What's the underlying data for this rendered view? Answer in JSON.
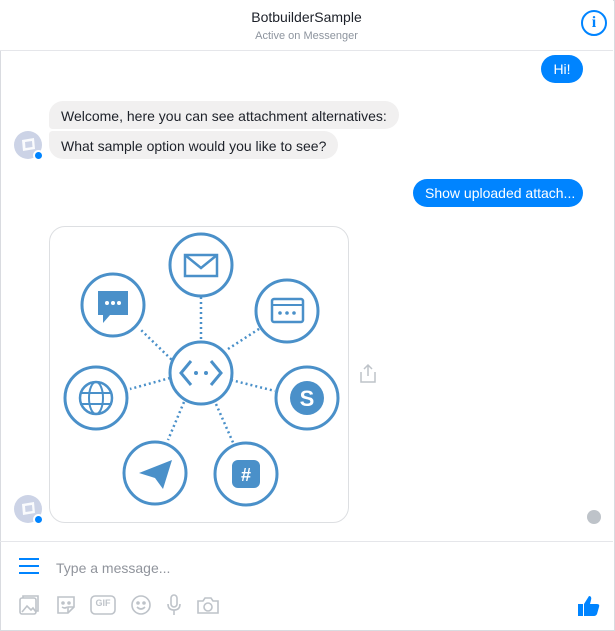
{
  "header": {
    "title": "BotbuilderSample",
    "subtitle": "Active on Messenger",
    "info_icon": "info-icon"
  },
  "messages": {
    "user_hi": "Hi!",
    "bot_welcome": "Welcome, here you can see attachment alternatives:",
    "bot_question": "What sample option would you like to see?",
    "user_show": "Show uploaded attach..."
  },
  "attachment": {
    "center_icon": "code-icon",
    "outer_icons": [
      "email-icon",
      "webchat-icon",
      "chat-bubble-icon",
      "globe-icon",
      "skype-icon",
      "telegram-icon",
      "slack-icon"
    ]
  },
  "composer": {
    "placeholder": "Type a message...",
    "toolbar_icons": [
      "gallery-icon",
      "sticker-icon",
      "gif-icon",
      "emoji-icon",
      "microphone-icon",
      "camera-icon"
    ],
    "gif_label": "GIF",
    "like_icon": "thumbs-up-icon"
  },
  "colors": {
    "accent": "#0084ff",
    "bot_bubble": "#f1f0f0",
    "diagram": "#4a90c9"
  }
}
